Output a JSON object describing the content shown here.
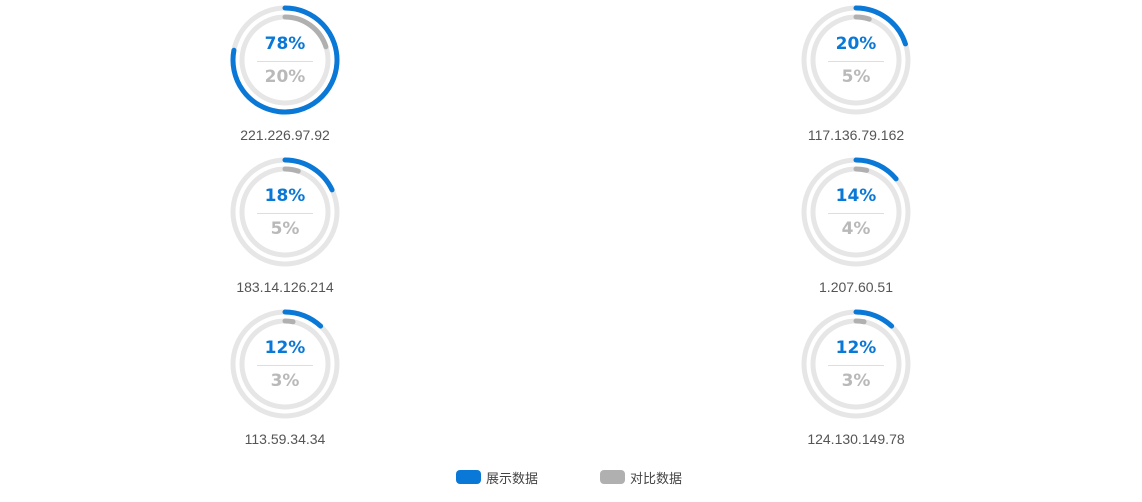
{
  "gauges": [
    {
      "ip": "221.226.97.92",
      "primary_label": "78%",
      "secondary_label": "20%",
      "primary_fraction": 0.78,
      "secondary_fraction": 0.2
    },
    {
      "ip": "117.136.79.162",
      "primary_label": "20%",
      "secondary_label": "5%",
      "primary_fraction": 0.2,
      "secondary_fraction": 0.05
    },
    {
      "ip": "183.14.126.214",
      "primary_label": "18%",
      "secondary_label": "5%",
      "primary_fraction": 0.18,
      "secondary_fraction": 0.05
    },
    {
      "ip": "1.207.60.51",
      "primary_label": "14%",
      "secondary_label": "4%",
      "primary_fraction": 0.14,
      "secondary_fraction": 0.04
    },
    {
      "ip": "113.59.34.34",
      "primary_label": "12%",
      "secondary_label": "3%",
      "primary_fraction": 0.12,
      "secondary_fraction": 0.03
    },
    {
      "ip": "124.130.149.78",
      "primary_label": "12%",
      "secondary_label": "3%",
      "primary_fraction": 0.12,
      "secondary_fraction": 0.03
    }
  ],
  "legend": {
    "primary": "展示数据",
    "secondary": "对比数据"
  },
  "colors": {
    "primary": "#0a78d6",
    "secondary": "#b0b0b0",
    "track": "#e6e6e6"
  }
}
